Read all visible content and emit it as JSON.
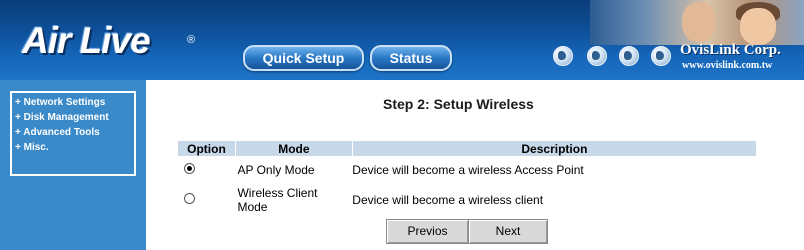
{
  "header": {
    "logo_text": "Air Live",
    "logo_mark": "®",
    "nav": {
      "quick_setup": "Quick Setup",
      "status": "Status"
    },
    "company": "OvisLink Corp.",
    "website": "www.ovislink.com.tw",
    "globe_icons": [
      "globe-icon",
      "globe-icon",
      "globe-icon",
      "globe-icon"
    ]
  },
  "sidebar": {
    "items": [
      {
        "label": "+ Network Settings"
      },
      {
        "label": "+ Disk Management"
      },
      {
        "label": "+ Advanced Tools"
      },
      {
        "label": "+ Misc."
      }
    ]
  },
  "main": {
    "title": "Step 2: Setup Wireless",
    "table": {
      "headers": {
        "option": "Option",
        "mode": "Mode",
        "description": "Description"
      },
      "rows": [
        {
          "selected": true,
          "mode": "AP Only Mode",
          "description": "Device will become a wireless Access Point"
        },
        {
          "selected": false,
          "mode": "Wireless Client Mode",
          "description": "Device will become a wireless client"
        }
      ]
    },
    "buttons": {
      "previous": "Previos",
      "next": "Next"
    }
  },
  "colors": {
    "header_blue": "#0d4e96",
    "sidebar_blue": "#3a8ac9",
    "table_header": "#c7d8e9"
  }
}
